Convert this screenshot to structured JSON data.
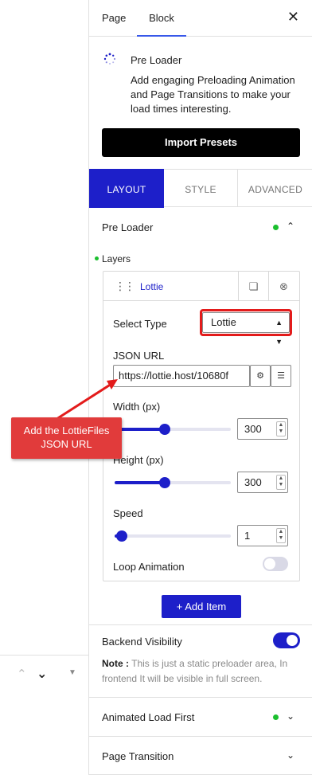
{
  "sidebar": {
    "tabs": [
      {
        "label": "Page"
      },
      {
        "label": "Block"
      }
    ],
    "close_icon": "close-icon",
    "block": {
      "icon": "loader-dots-icon",
      "title": "Pre Loader",
      "description": "Add engaging Preloading Animation and Page Transitions to make your load times interesting."
    },
    "import_button": "Import Presets",
    "main_tabs": [
      {
        "label": "LAYOUT"
      },
      {
        "label": "STYLE"
      },
      {
        "label": "ADVANCED"
      }
    ],
    "sections": {
      "pre_loader": "Pre Loader",
      "layers": "Layers",
      "animated_load_first": "Animated Load First",
      "page_transition": "Page Transition"
    },
    "layer": {
      "name": "Lottie",
      "select_type_label": "Select Type",
      "select_type_value": "Lottie",
      "json_url_label": "JSON URL",
      "json_url_value": "https://lottie.host/10680f",
      "width_label": "Width (px)",
      "width_value": "300",
      "height_label": "Height (px)",
      "height_value": "300",
      "speed_label": "Speed",
      "speed_value": "1",
      "loop_label": "Loop Animation",
      "loop_enabled": false
    },
    "add_item": "+ Add Item",
    "backend_visibility": {
      "label": "Backend Visibility",
      "enabled": true,
      "note_prefix": "Note :",
      "note_text": " This is just a static preloader area, In frontend It will be visible in full screen."
    }
  },
  "annotation": {
    "text": "Add the LottieFiles JSON URL"
  },
  "colors": {
    "accent": "#1d1fc9",
    "status_dot": "#1bbf2e",
    "annotation_red": "#e13b3b"
  }
}
